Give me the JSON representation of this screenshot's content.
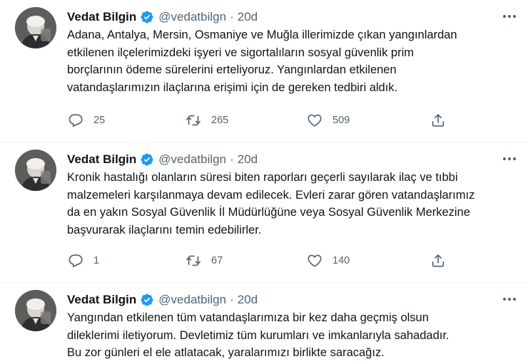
{
  "tweets": [
    {
      "name": "Vedat Bilgin",
      "handle": "@vedatbilgn",
      "dot": "·",
      "time": "20d",
      "lines": [
        "Adana, Antalya, Mersin, Osmaniye ve Muğla illerimizde çıkan yangınlardan",
        "etkilenen ilçelerimizdeki işyeri ve sigortalıların sosyal güvenlik prim",
        "borçlarının ödeme sürelerini erteliyoruz. Yangınlardan etkilenen",
        "vatandaşlarımızın ilaçlarına erişimi için de gereken tedbiri aldık."
      ],
      "replies": "25",
      "retweets": "265",
      "likes": "509"
    },
    {
      "name": "Vedat Bilgin",
      "handle": "@vedatbilgn",
      "dot": "·",
      "time": "20d",
      "lines": [
        "Kronik hastalığı olanların süresi biten raporları geçerli sayılarak ilaç ve tıbbi",
        "malzemeleri karşılanmaya devam edilecek. Evleri zarar gören vatandaşlarımız",
        "da en yakın Sosyal Güvenlik İl Müdürlüğüne veya Sosyal Güvenlik Merkezine",
        "başvurarak ilaçlarını temin edebilirler."
      ],
      "replies": "1",
      "retweets": "67",
      "likes": "140"
    },
    {
      "name": "Vedat Bilgin",
      "handle": "@vedatbilgn",
      "dot": "·",
      "time": "20d",
      "lines": [
        "Yangından etkilenen tüm vatandaşlarımıza bir kez daha geçmiş olsun",
        "dileklerimi iletiyorum. Devletimiz tüm kurumları ve imkanlarıyla sahadadır.",
        "Bu zor günleri el ele atlatacak, yaralarımızı birlikte saracağız."
      ]
    }
  ],
  "icons": {
    "verified": "verified-badge-icon",
    "more": "more-options-icon",
    "reply": "reply-icon",
    "retweet": "retweet-icon",
    "like": "like-icon",
    "share": "share-icon"
  },
  "colors": {
    "verified": "#1d9bf0",
    "muted": "#536471",
    "text": "#0f1419",
    "divider": "#eff3f4"
  }
}
